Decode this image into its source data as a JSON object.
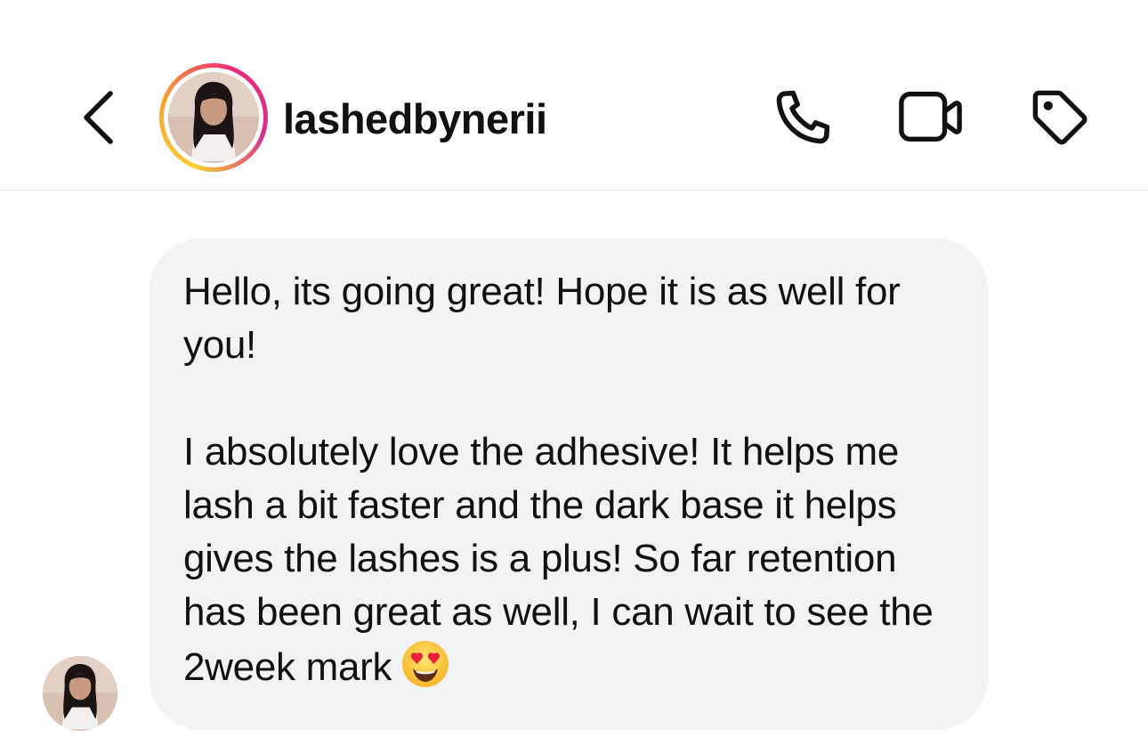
{
  "header": {
    "username": "lashedbynerii",
    "ring_colors": [
      "#f9ce34",
      "#ee2a7b",
      "#d62f8c"
    ]
  },
  "icons": {
    "back": "chevron-left-icon",
    "call": "phone-icon",
    "video": "video-camera-icon",
    "tag": "tag-icon",
    "emoji": "heart-eyes-emoji"
  },
  "message": {
    "paragraph_1": "Hello, its going great! Hope it is as well for you!",
    "paragraph_2": "I absolutely love the adhesive! It helps me lash a bit faster and the dark base it helps gives the lashes is a plus! So far retention has been great as well, I can wait to see the 2week mark",
    "emoji_char": "😍",
    "bubble_color": "#f2f3f5"
  }
}
